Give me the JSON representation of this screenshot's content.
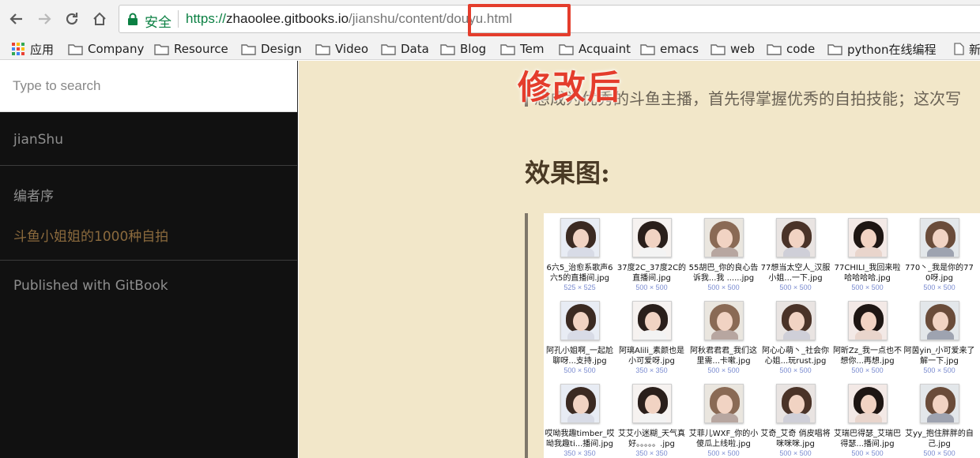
{
  "browser": {
    "secure_label": "安全",
    "url": {
      "scheme": "https://",
      "host": "zhaoolee.gitbooks.io",
      "path": "/jianshu/content/douyu.html"
    },
    "bookmarks": [
      {
        "label": "应用",
        "icon": "apps-grid-icon"
      },
      {
        "label": "Company",
        "icon": "folder-icon"
      },
      {
        "label": "Resource",
        "icon": "folder-icon"
      },
      {
        "label": "Design",
        "icon": "folder-icon"
      },
      {
        "label": "Video",
        "icon": "folder-icon"
      },
      {
        "label": "Data",
        "icon": "folder-icon"
      },
      {
        "label": "Blog",
        "icon": "folder-icon"
      },
      {
        "label": "Tem",
        "icon": "folder-icon"
      },
      {
        "label": "Acquaint",
        "icon": "folder-icon"
      },
      {
        "label": "emacs",
        "icon": "folder-icon"
      },
      {
        "label": "web",
        "icon": "folder-icon"
      },
      {
        "label": "code",
        "icon": "folder-icon"
      },
      {
        "label": "python在线编程",
        "icon": "folder-icon"
      },
      {
        "label": "新",
        "icon": "page-icon"
      }
    ]
  },
  "sidebar": {
    "search_placeholder": "Type to search",
    "items": [
      {
        "label": "jianShu"
      },
      {
        "label": "编者序"
      },
      {
        "label": "斗鱼小姐姐的1000种自拍",
        "active": true
      },
      {
        "label": "Published with GitBook"
      }
    ]
  },
  "main": {
    "annotation": "修改后",
    "intro_text": "想成为优秀的斗鱼主播，首先得掌握优秀的自拍技能；这次写",
    "section_title": "效果图:",
    "files": [
      {
        "name": "6六5_治愈系歌声6六5的直播间.jpg",
        "size": "525 × 525"
      },
      {
        "name": "37度2C_37度2C的直播间.jpg",
        "size": "500 × 500"
      },
      {
        "name": "55胡巴_你的良心告诉我...我 ......jpg",
        "size": "500 × 500"
      },
      {
        "name": "77想当太空人_汉服小姐...一下.jpg",
        "size": "500 × 500"
      },
      {
        "name": "77CHILI_我回来啦哈哈哈哈.jpg",
        "size": "500 × 500"
      },
      {
        "name": "770丶_我是你的770呀.jpg",
        "size": "500 × 500"
      },
      {
        "name": "阿孔小姐啊_一起尬聊呀...支持.jpg",
        "size": "500 × 500"
      },
      {
        "name": "阿璃Alili_素颜也是小可爱呀.jpg",
        "size": "350 × 350"
      },
      {
        "name": "阿秋君君君_我们这里需...卡嗽.jpg",
        "size": "500 × 500"
      },
      {
        "name": "阿心心萌丶_社会你心姐...玩rust.jpg",
        "size": "500 × 500"
      },
      {
        "name": "阿昕Zz_我一点也不想你...再想.jpg",
        "size": "500 × 500"
      },
      {
        "name": "阿茵yin_小可爱来了解一下.jpg",
        "size": "500 × 500"
      },
      {
        "name": "哎呦我趣timber_哎呦我趣ti...播间.jpg",
        "size": "350 × 350"
      },
      {
        "name": "艾艾小迷糊_天气真好。。。。。.jpg",
        "size": "350 × 350"
      },
      {
        "name": "艾菲儿WXF_你的小傻瓜上线啦.jpg",
        "size": "500 × 500"
      },
      {
        "name": "艾奇_艾奇 俏皮唱将咪咪咪.jpg",
        "size": "500 × 500"
      },
      {
        "name": "艾瑞巴得瑟_艾瑞巴得瑟...播间.jpg",
        "size": "500 × 500"
      },
      {
        "name": "艾yy_抱住胖胖的自己.jpg",
        "size": "500 × 500"
      }
    ]
  }
}
